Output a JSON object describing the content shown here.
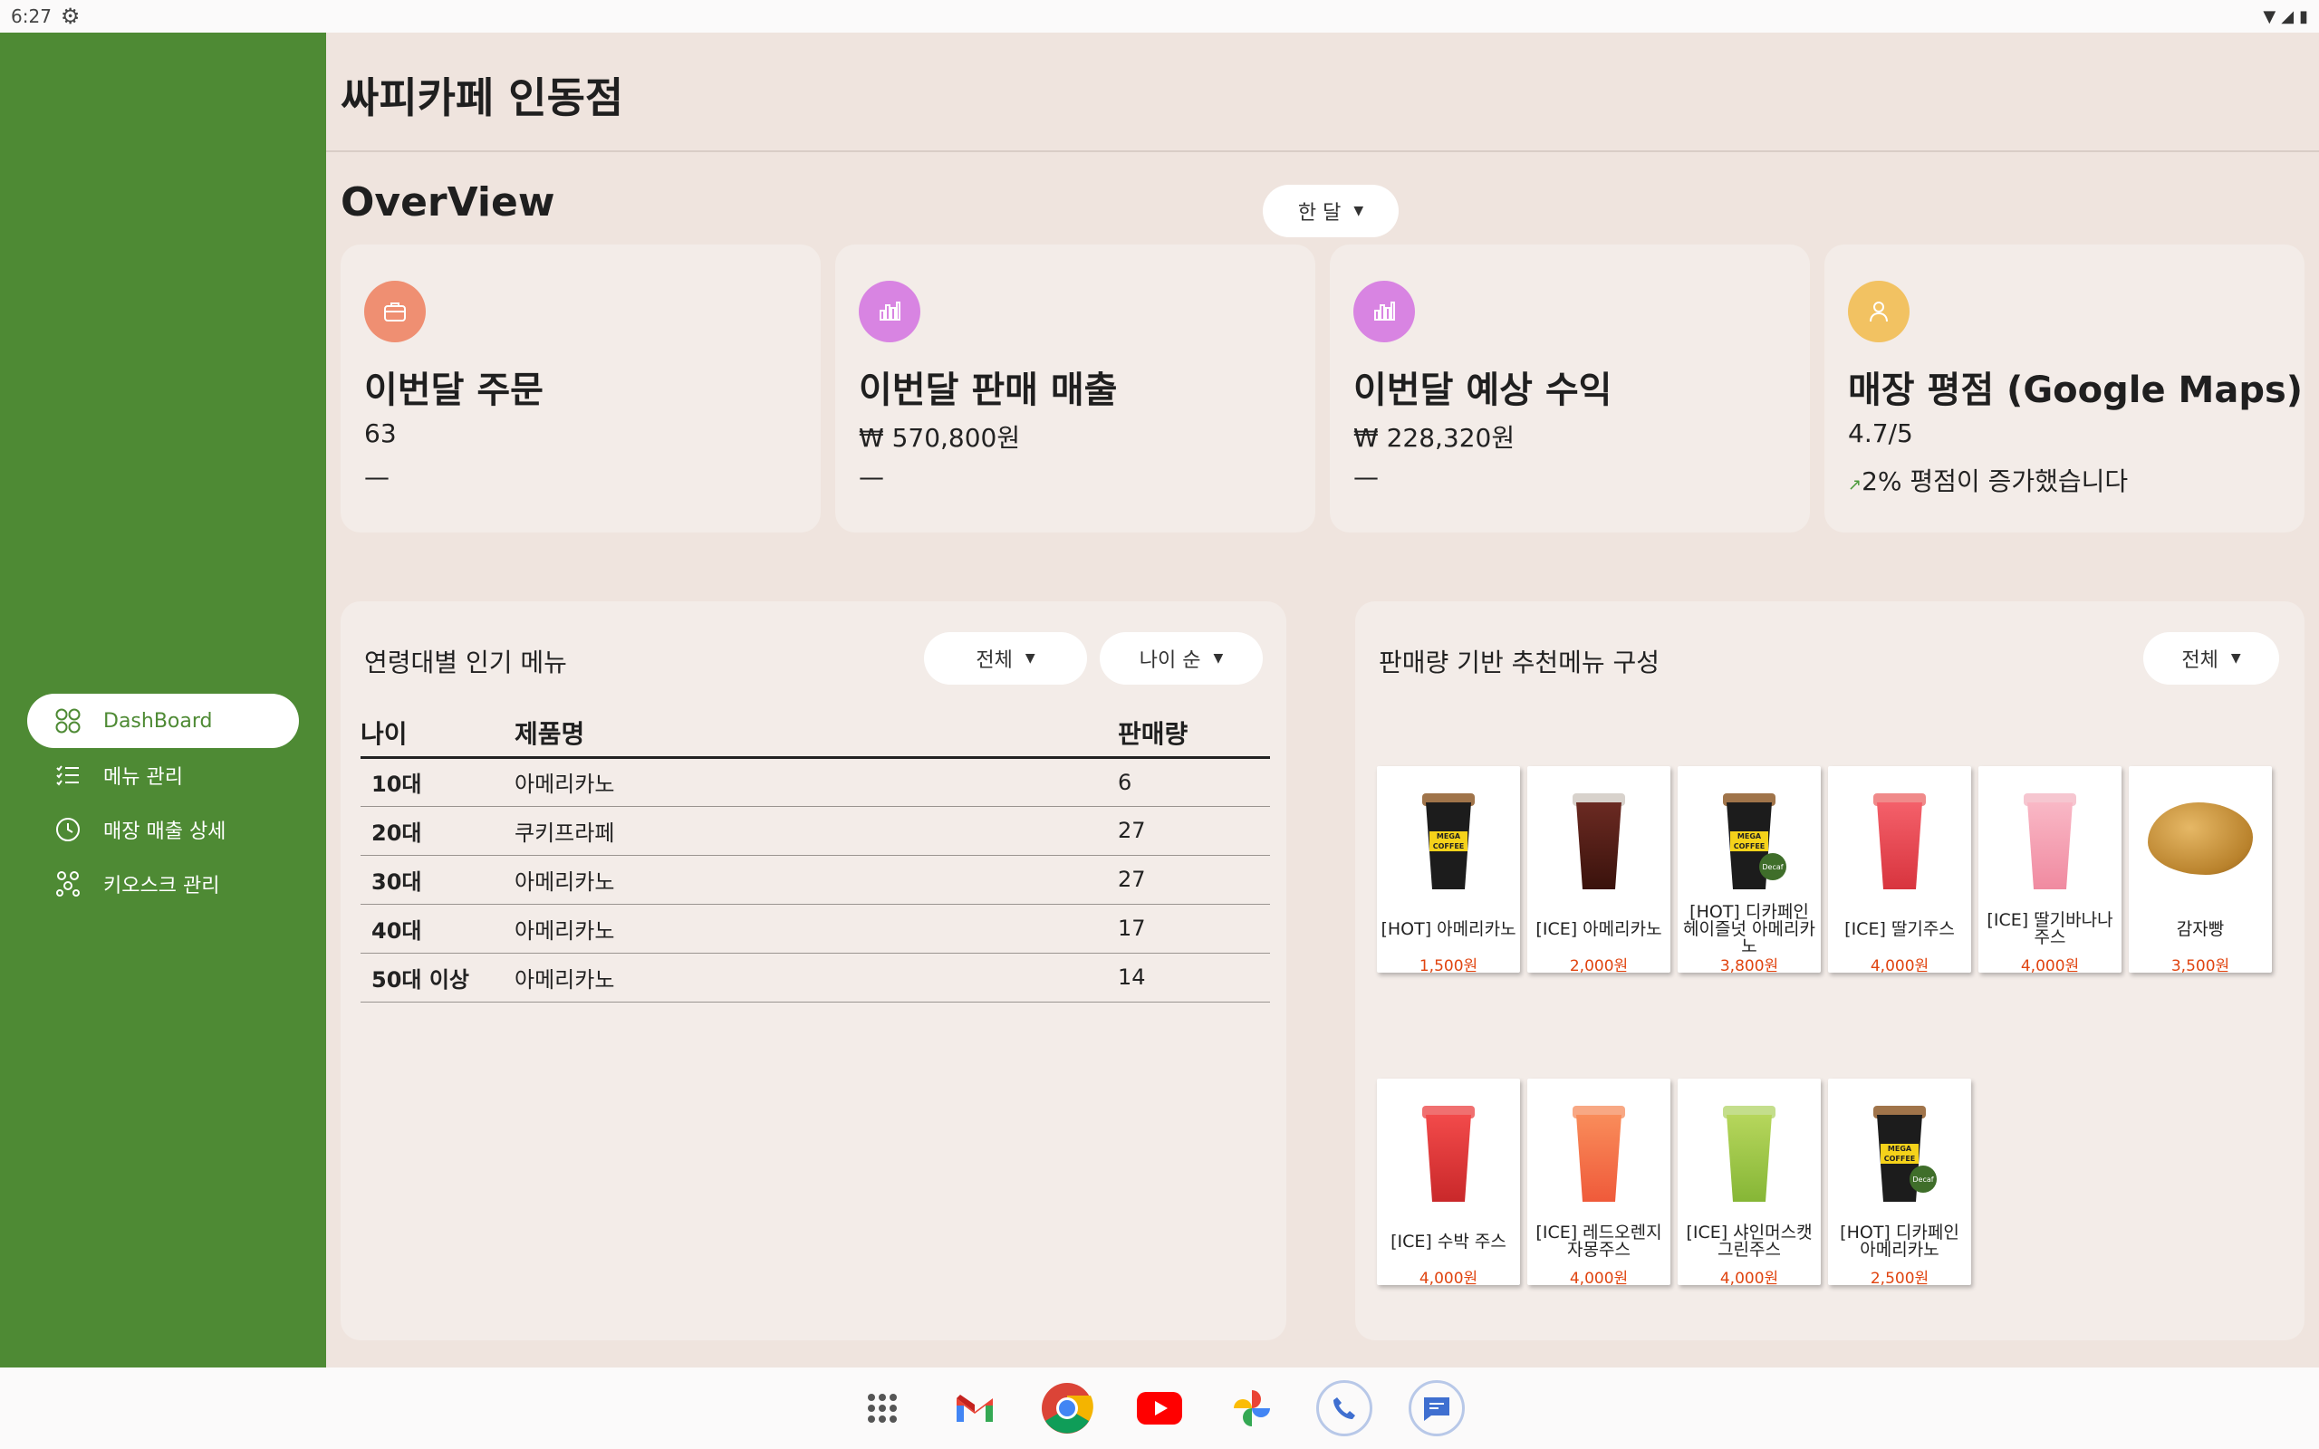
{
  "status_bar": {
    "time": "6:27"
  },
  "header": {
    "title": "싸피카페 인동점"
  },
  "sidebar": {
    "items": [
      {
        "label": "DashBoard",
        "icon": "grid-icon",
        "active": true
      },
      {
        "label": "메뉴 관리",
        "icon": "list-icon",
        "active": false
      },
      {
        "label": "매장 매출 상세",
        "icon": "clock-icon",
        "active": false
      },
      {
        "label": "키오스크 관리",
        "icon": "nodes-icon",
        "active": false
      }
    ]
  },
  "overview": {
    "title": "OverView",
    "period_dropdown": "한 달",
    "cards": [
      {
        "label": "이번달 주문",
        "value": "63",
        "delta": "—",
        "icon": "briefcase-icon",
        "icon_color": "#ef8f72"
      },
      {
        "label": "이번달 판매 매출",
        "value": "₩ 570,800원",
        "delta": "—",
        "icon": "bar-chart-icon",
        "icon_color": "#d884e2"
      },
      {
        "label": "이번달 예상 수익",
        "value": "₩ 228,320원",
        "delta": "—",
        "icon": "bar-chart-icon",
        "icon_color": "#d884e2"
      },
      {
        "label": "매장 평점 (Google Maps)",
        "value": "4.7/5",
        "delta": "2% 평점이 증가했습니다",
        "icon": "person-icon",
        "icon_color": "#f2c262"
      }
    ]
  },
  "age_panel": {
    "title": "연령대별 인기 메뉴",
    "filter_dropdown": "전체",
    "sort_dropdown": "나이 순",
    "columns": [
      "나이",
      "제품명",
      "판매량"
    ],
    "rows": [
      {
        "age": "10대",
        "product": "아메리카노",
        "sales": "6"
      },
      {
        "age": "20대",
        "product": "쿠키프라페",
        "sales": "27"
      },
      {
        "age": "30대",
        "product": "아메리카노",
        "sales": "27"
      },
      {
        "age": "40대",
        "product": "아메리카노",
        "sales": "17"
      },
      {
        "age": "50대 이상",
        "product": "아메리카노",
        "sales": "14"
      }
    ]
  },
  "recommend_panel": {
    "title": "판매량 기반 추천메뉴 구성",
    "filter_dropdown": "전체",
    "items": [
      {
        "name": "[HOT] 아메리카노",
        "price": "1,500원"
      },
      {
        "name": "[ICE] 아메리카노",
        "price": "2,000원"
      },
      {
        "name": "[HOT] 디카페인 헤이즐넛 아메리카노",
        "price": "3,800원"
      },
      {
        "name": "[ICE] 딸기주스",
        "price": "4,000원"
      },
      {
        "name": "[ICE] 딸기바나나주스",
        "price": "4,000원"
      },
      {
        "name": "감자빵",
        "price": "3,500원"
      },
      {
        "name": "[ICE] 수박 주스",
        "price": "4,000원"
      },
      {
        "name": "[ICE] 레드오렌지자몽주스",
        "price": "4,000원"
      },
      {
        "name": "[ICE] 샤인머스캣그린주스",
        "price": "4,000원"
      },
      {
        "name": "[HOT] 디카페인 아메리카노",
        "price": "2,500원"
      }
    ]
  },
  "taskbar": {
    "apps": [
      "apps-grid-icon",
      "gmail-icon",
      "chrome-icon",
      "youtube-icon",
      "photos-icon",
      "phone-icon",
      "messages-icon"
    ]
  }
}
